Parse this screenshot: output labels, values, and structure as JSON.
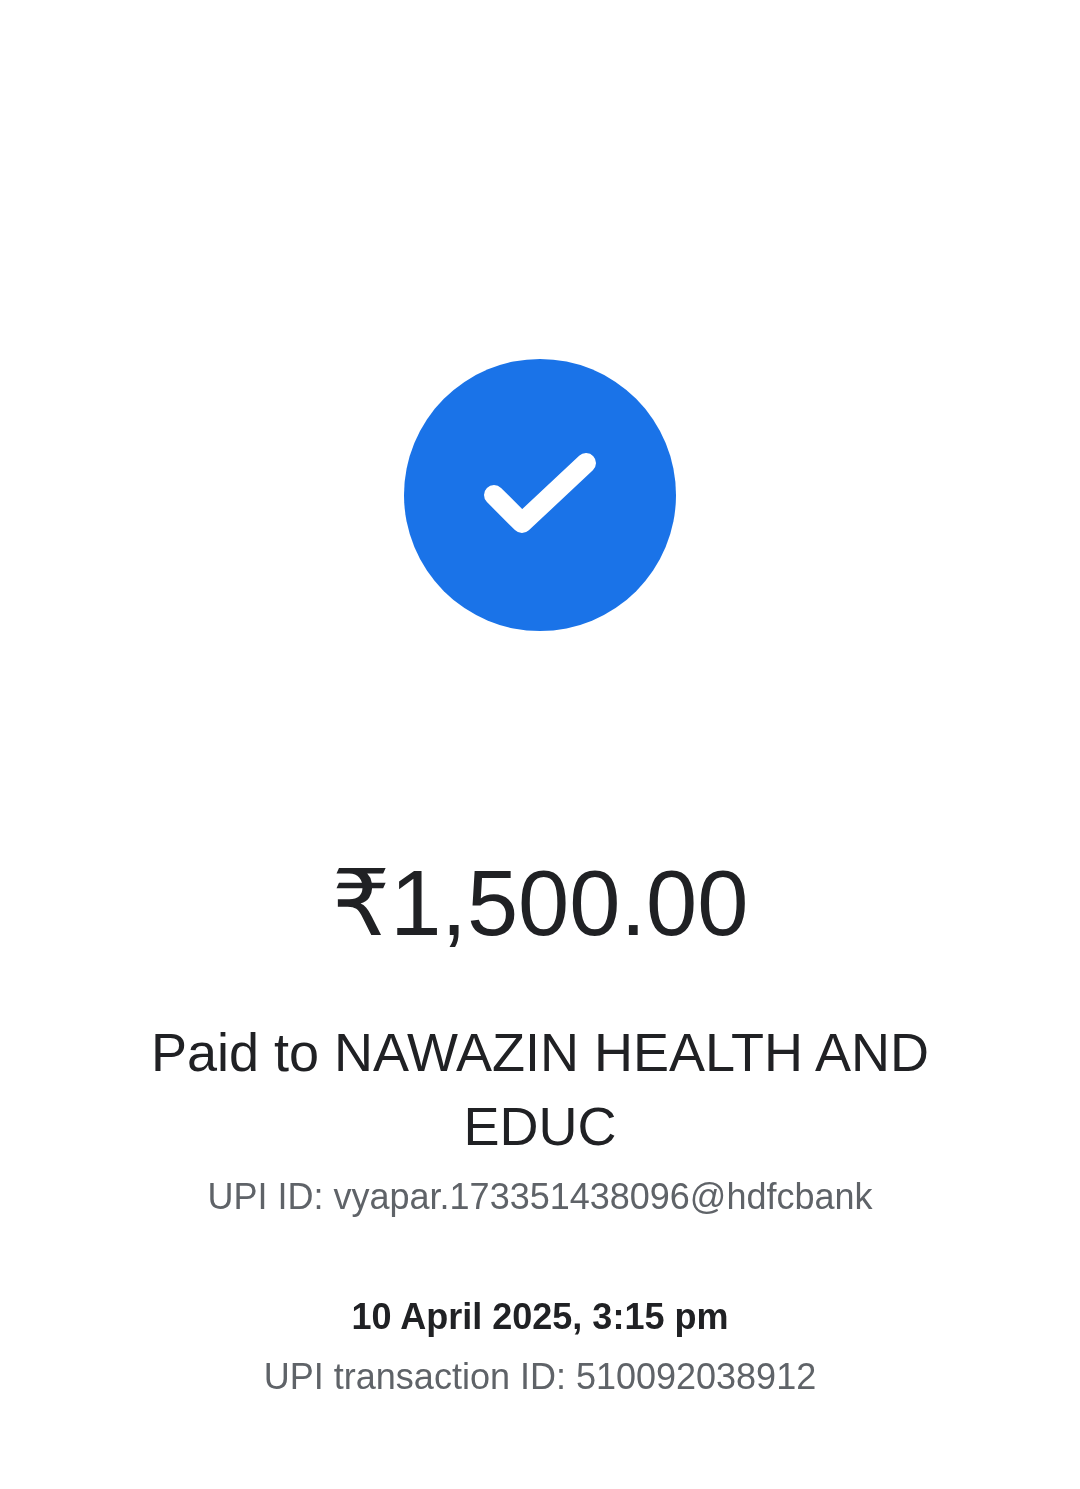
{
  "status": {
    "success": true
  },
  "amount": "₹1,500.00",
  "payee": "Paid to NAWAZIN HEALTH AND EDUC",
  "upi_id": "UPI ID: vyapar.173351438096@hdfcbank",
  "date_time": "10 April 2025, 3:15 pm",
  "transaction_id": "UPI transaction ID: 510092038912"
}
